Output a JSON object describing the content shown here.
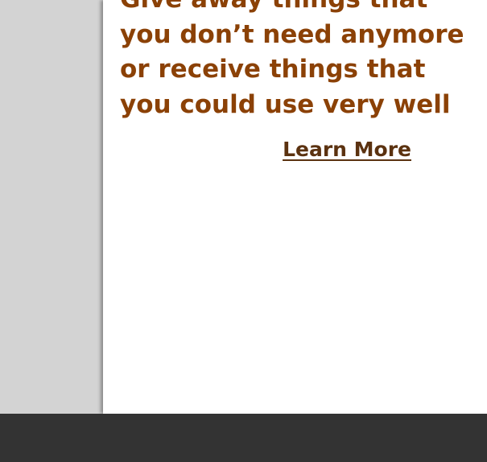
{
  "hero": {
    "tagline": "Give away things that you don’t need anymore or receive things that you could use very well",
    "cta_label": "Learn More"
  },
  "colors": {
    "tagline": "#8b4106",
    "link": "#5b3210",
    "footer": "#333333",
    "sidebar": "#d3d3d3",
    "content": "#ffffff"
  }
}
